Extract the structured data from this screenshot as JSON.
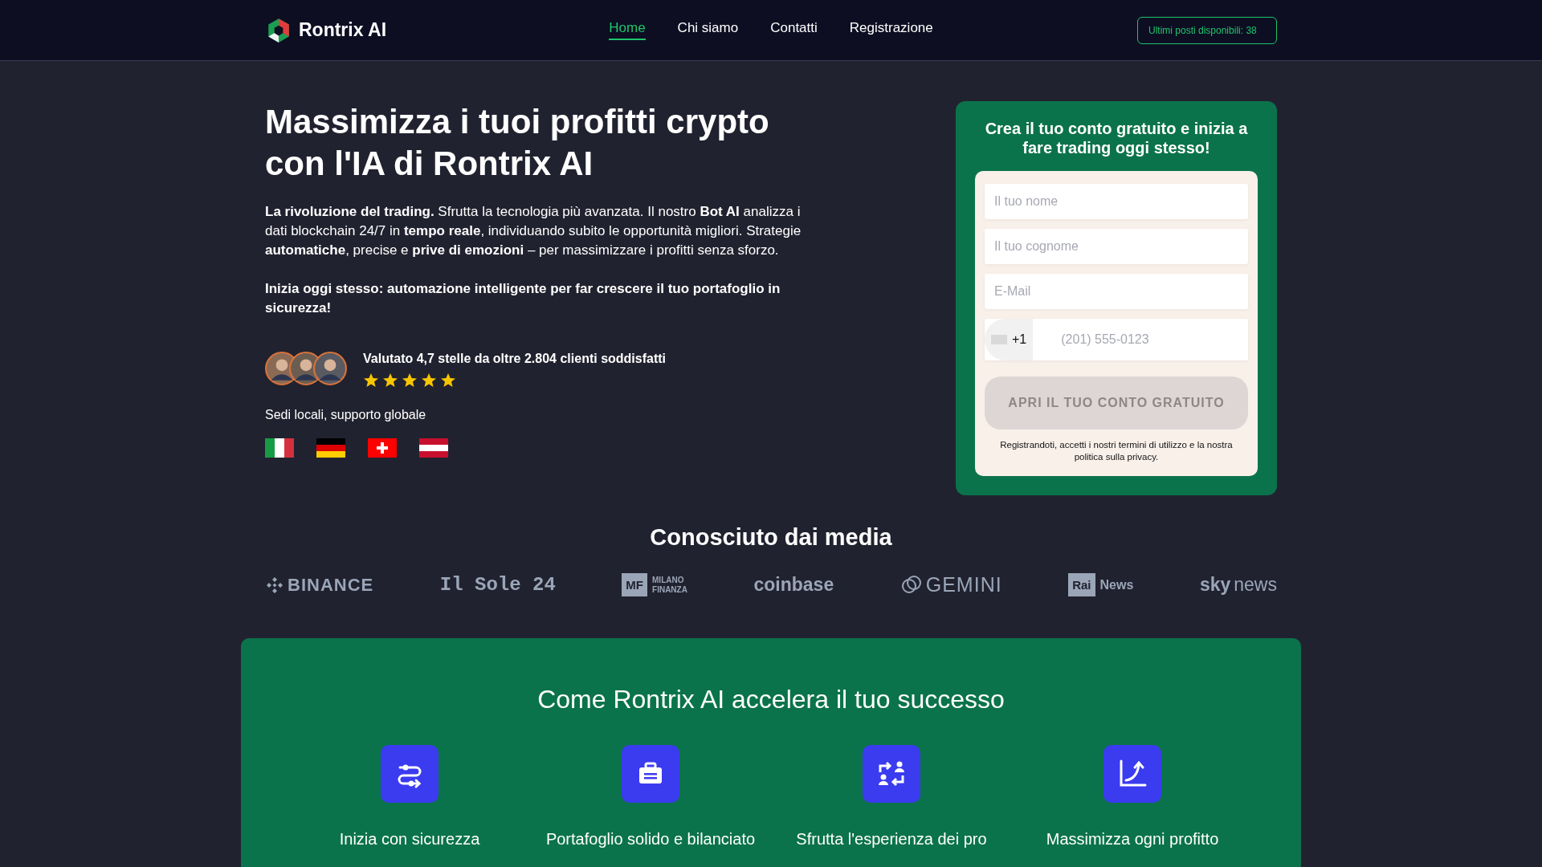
{
  "header": {
    "logo": "Rontrix AI",
    "nav": [
      {
        "label": "Home",
        "selected": true
      },
      {
        "label": "Chi siamo",
        "selected": false
      },
      {
        "label": "Contatti",
        "selected": false
      },
      {
        "label": "Registrazione",
        "selected": false
      }
    ],
    "badge": "Ultimi posti disponibili: 38"
  },
  "hero": {
    "title": "Massimizza i tuoi profitti crypto con l'IA di Rontrix AI",
    "intro": "**La rivoluzione del trading.** Sfrutta la tecnologia più avanzata. Il nostro **Bot AI** analizza i dati blockchain 24/7 in **tempo reale**, individuando subito le opportunità migliori. Strategie **automatiche**, precise e **prive di emozioni** – per massimizzare i profitti senza sforzo.",
    "cta": "Inizia oggi stesso: automazione intelligente per far crescere il tuo portafoglio in sicurezza!",
    "rating": {
      "text": "Valutato 4,7 stelle da oltre 2.804 clienti soddisfatti",
      "stars": 5
    },
    "offices": "Sedi locali, supporto globale",
    "flags": [
      {
        "kind": "italy"
      },
      {
        "kind": "germany"
      },
      {
        "kind": "switzerland"
      },
      {
        "kind": "austria"
      }
    ]
  },
  "form": {
    "title": "Crea il tuo conto gratuito e inizia a fare trading oggi stesso!",
    "fields": [
      {
        "placeholder": "Il tuo nome"
      },
      {
        "placeholder": "Il tuo cognome"
      },
      {
        "placeholder": "E-Mail"
      }
    ],
    "phone": {
      "code": "+1",
      "placeholder": "(201) 555-0123"
    },
    "submit": {
      "label": "APRI IL TUO CONTO GRATUITO",
      "disabled": true
    },
    "legal": "Registrandoti, accetti i nostri termini di utilizzo e la nostra politica sulla privacy."
  },
  "media": {
    "title": "Conosciuto dai media",
    "logos": [
      {
        "kind": "binance",
        "text": "BINANCE"
      },
      {
        "kind": "mono",
        "text": "Il Sole 24"
      },
      {
        "kind": "boxed",
        "box": "MF",
        "lines": [
          "MILANO",
          "FINANZA"
        ]
      },
      {
        "kind": "plain",
        "text": "coinbase"
      },
      {
        "kind": "gemini",
        "text": "GEMINI"
      },
      {
        "kind": "boxed",
        "box": "Rai",
        "lines": [
          "News"
        ]
      },
      {
        "kind": "sky",
        "text": "**sky**news"
      }
    ]
  },
  "features": {
    "title": "Come Rontrix AI accelera il tuo successo",
    "items": [
      {
        "kind": "sliders",
        "label": "Inizia con sicurezza"
      },
      {
        "kind": "briefcase",
        "label": "Portafoglio solido e bilanciato"
      },
      {
        "kind": "exchange",
        "label": "Sfrutta l'esperienza dei pro"
      },
      {
        "kind": "growth",
        "label": "Massimizza ogni profitto"
      }
    ]
  }
}
